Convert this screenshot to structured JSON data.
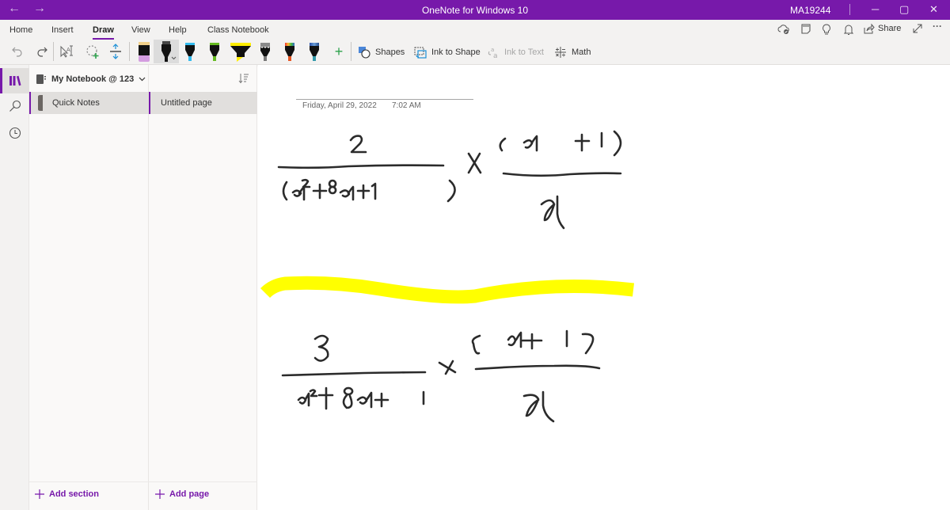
{
  "titlebar": {
    "title": "OneNote for Windows 10",
    "user": "MA19244",
    "back": "←",
    "forward": "→",
    "minimize": "─",
    "maximize": "▢",
    "close": "✕"
  },
  "ribbon": {
    "tabs": [
      {
        "label": "Home"
      },
      {
        "label": "Insert"
      },
      {
        "label": "Draw",
        "active": true
      },
      {
        "label": "View"
      },
      {
        "label": "Help"
      },
      {
        "label": "Class Notebook"
      }
    ],
    "tools": {
      "undo": "undo-icon",
      "redo": "redo-icon",
      "type_select": "lasso-select-icon",
      "lasso": "add-space-icon",
      "add_space": "insert-space-icon"
    },
    "pens": [
      {
        "name": "eraser",
        "color": "#d9a7e6"
      },
      {
        "name": "black-pen",
        "color": "#222222",
        "selected": true
      },
      {
        "name": "cyan-pen",
        "color": "#33bbee"
      },
      {
        "name": "green-pen",
        "color": "#66bb22"
      },
      {
        "name": "yellow-highlighter",
        "color": "#ffee00"
      },
      {
        "name": "galaxy-pen",
        "color": "#888888"
      },
      {
        "name": "rainbow-pen",
        "color": "#ee5522"
      },
      {
        "name": "ocean-pen",
        "color": "#3399aa"
      }
    ],
    "add_pen": "+",
    "buttons": {
      "shapes": "Shapes",
      "ink_to_shape": "Ink to Shape",
      "ink_to_text": "Ink to Text",
      "math": "Math"
    },
    "right": {
      "share": "Share",
      "more": "···"
    }
  },
  "notebook": {
    "title": "My Notebook @ 123",
    "sections": [
      {
        "label": "Quick Notes"
      }
    ],
    "pages": [
      {
        "label": "Untitled page"
      }
    ],
    "add_section": "Add section",
    "add_page": "Add page"
  },
  "page": {
    "date": "Friday, April 29, 2022",
    "time": "7:02 AM",
    "ink_expressions": [
      "2 / (x^2 + 8x + 1) × (x + 1) / x",
      "3 / (x^2 + 8x + 1) × (x + 1) / x"
    ],
    "highlight_color": "#ffff00"
  }
}
